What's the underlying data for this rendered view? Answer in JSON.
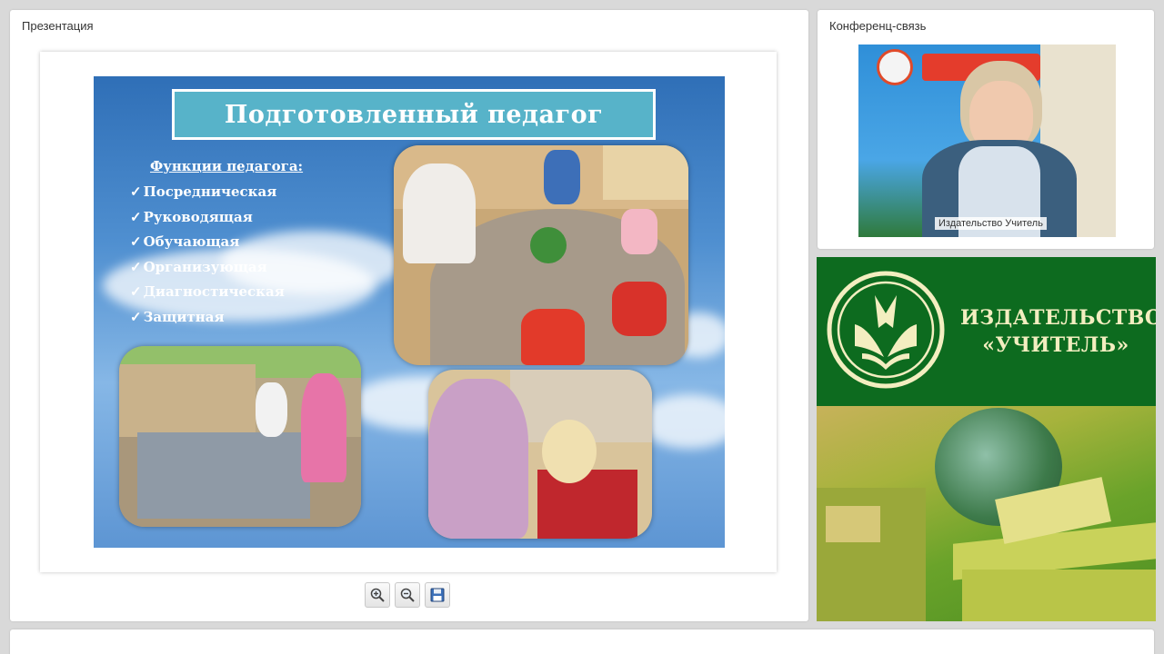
{
  "presentation": {
    "title": "Презентация",
    "slide": {
      "title": "Подготовленный педагог",
      "functions_heading": "Функции педагога:",
      "check_mark": "✓",
      "functions": [
        "Посредническая",
        "Руководящая",
        "Обучающая",
        "Организующая",
        "Диагностическая",
        "Защитная"
      ]
    },
    "toolbar": {
      "zoom_in_icon": "zoom-in-icon",
      "zoom_out_icon": "zoom-out-icon",
      "save_icon": "floppy-disk-icon"
    }
  },
  "conference": {
    "title": "Конференц-связь",
    "participant_name": "Издательство Учитель"
  },
  "publisher_banner": {
    "line1": "ИЗДАТЕЛЬСТВО",
    "line2": "«УЧИТЕЛЬ»"
  },
  "colors": {
    "slide_title_box": "#57b3c9",
    "banner_green": "#0d6b1f",
    "banner_text": "#f3eec0"
  }
}
